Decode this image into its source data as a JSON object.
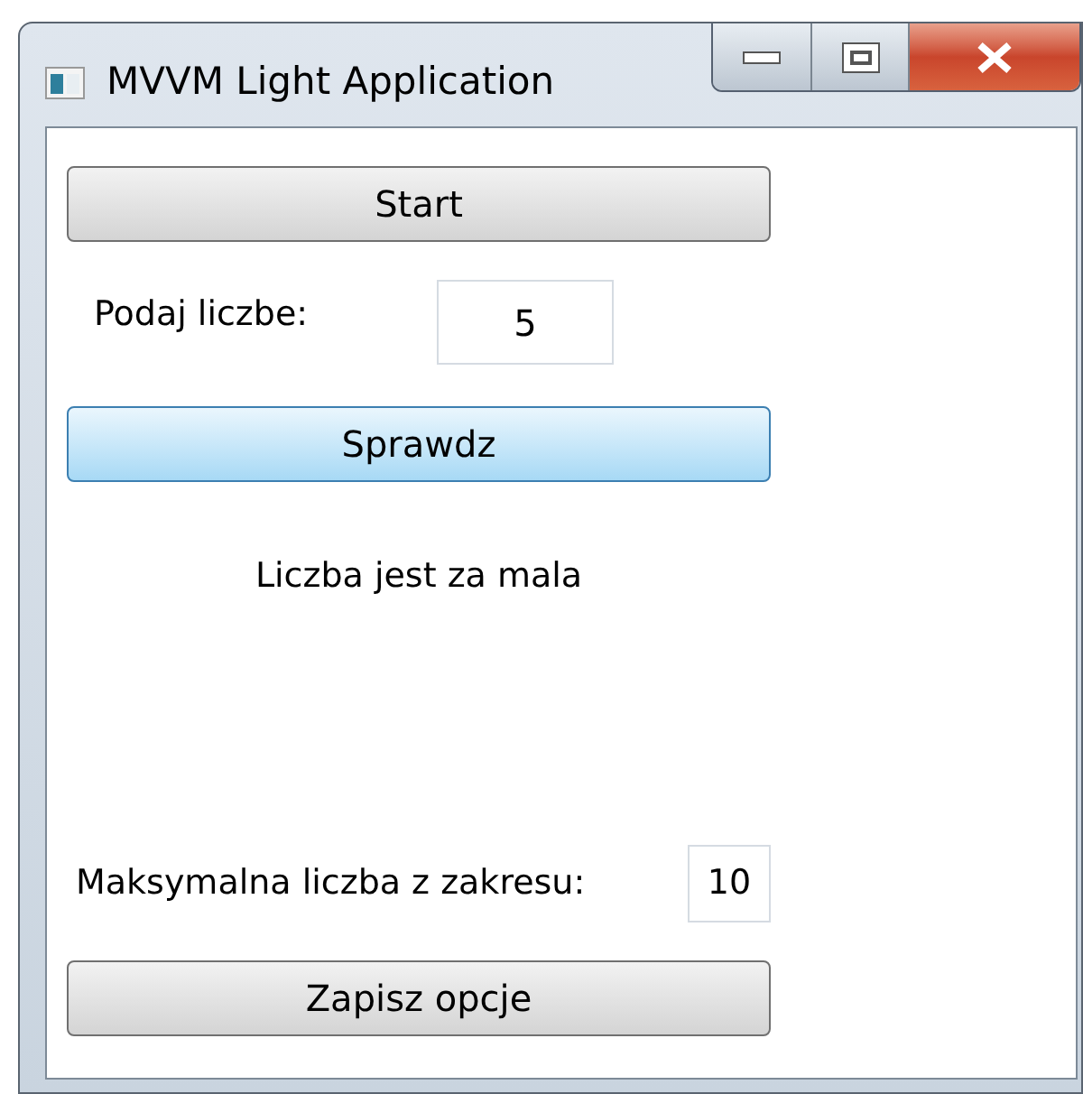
{
  "window": {
    "title": "MVVM Light Application"
  },
  "start_button": {
    "label": "Start",
    "highlighted": false
  },
  "number_field": {
    "label": "Podaj liczbe:",
    "value": "5"
  },
  "check_button": {
    "label": "Sprawdz",
    "highlighted": true
  },
  "result_message": "Liczba jest za mala",
  "max_field": {
    "label": "Maksymalna liczba z zakresu:",
    "value": "10"
  },
  "save_button": {
    "label": "Zapisz opcje",
    "highlighted": false
  }
}
